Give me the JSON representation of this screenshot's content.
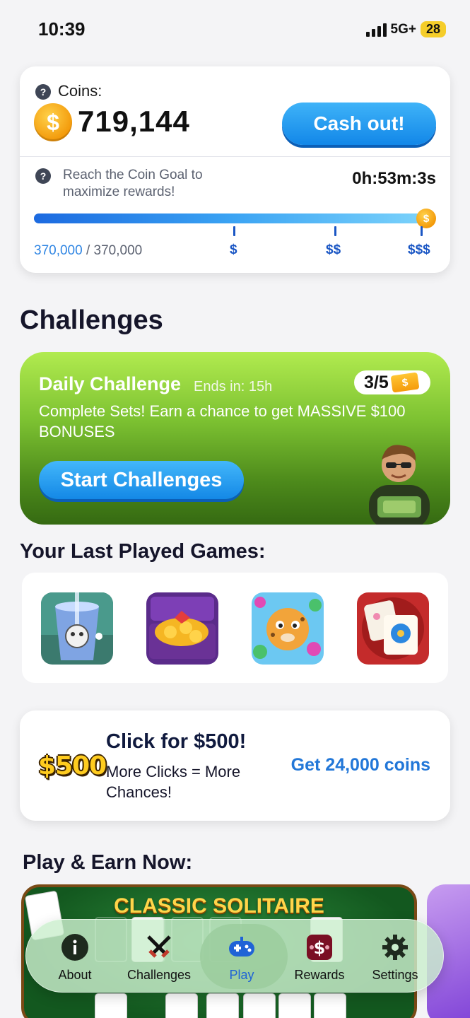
{
  "status_bar": {
    "time": "10:39",
    "network": "5G+",
    "battery": "28"
  },
  "coins": {
    "label": "Coins:",
    "amount": "719,144",
    "cashout_label": "Cash out!",
    "goal_text": "Reach the Coin Goal to maximize rewards!",
    "timer": "0h:53m:3s",
    "progress_fraction": 1.0,
    "progress_current": "370,000",
    "progress_separator": " / ",
    "progress_target": "370,000",
    "tiers": [
      "$",
      "$$",
      "$$$"
    ]
  },
  "challenges": {
    "section_title": "Challenges",
    "daily": {
      "title": "Daily Challenge",
      "ends": "Ends in: 15h",
      "progress": "3/5",
      "description": "Complete Sets! Earn a chance to get MASSIVE $100 BONUSES",
      "button_label": "Start Challenges"
    }
  },
  "last_played": {
    "title": "Your Last Played Games:",
    "games": [
      "ball-drop-game-icon",
      "treasure-chest-game-icon",
      "cheetah-bubble-game-icon",
      "mahjong-flower-game-icon"
    ]
  },
  "promo": {
    "badge": "$500",
    "title": "Click for $500!",
    "subtitle": "More Clicks = More Chances!",
    "cta": "Get 24,000 coins"
  },
  "play_earn": {
    "title": "Play & Earn Now:",
    "featured_game": "CLASSIC SOLITAIRE"
  },
  "nav": {
    "items": [
      {
        "label": "About",
        "icon": "info-icon"
      },
      {
        "label": "Challenges",
        "icon": "crossed-swords-icon"
      },
      {
        "label": "Play",
        "icon": "gamepad-icon"
      },
      {
        "label": "Rewards",
        "icon": "cash-icon"
      },
      {
        "label": "Settings",
        "icon": "gear-icon"
      }
    ],
    "active": "Play"
  },
  "colors": {
    "accent": "#1f63d6",
    "cta_blue": "#1488e6",
    "challenge_green": "#7cc131",
    "coin_gold": "#f39a0b"
  }
}
